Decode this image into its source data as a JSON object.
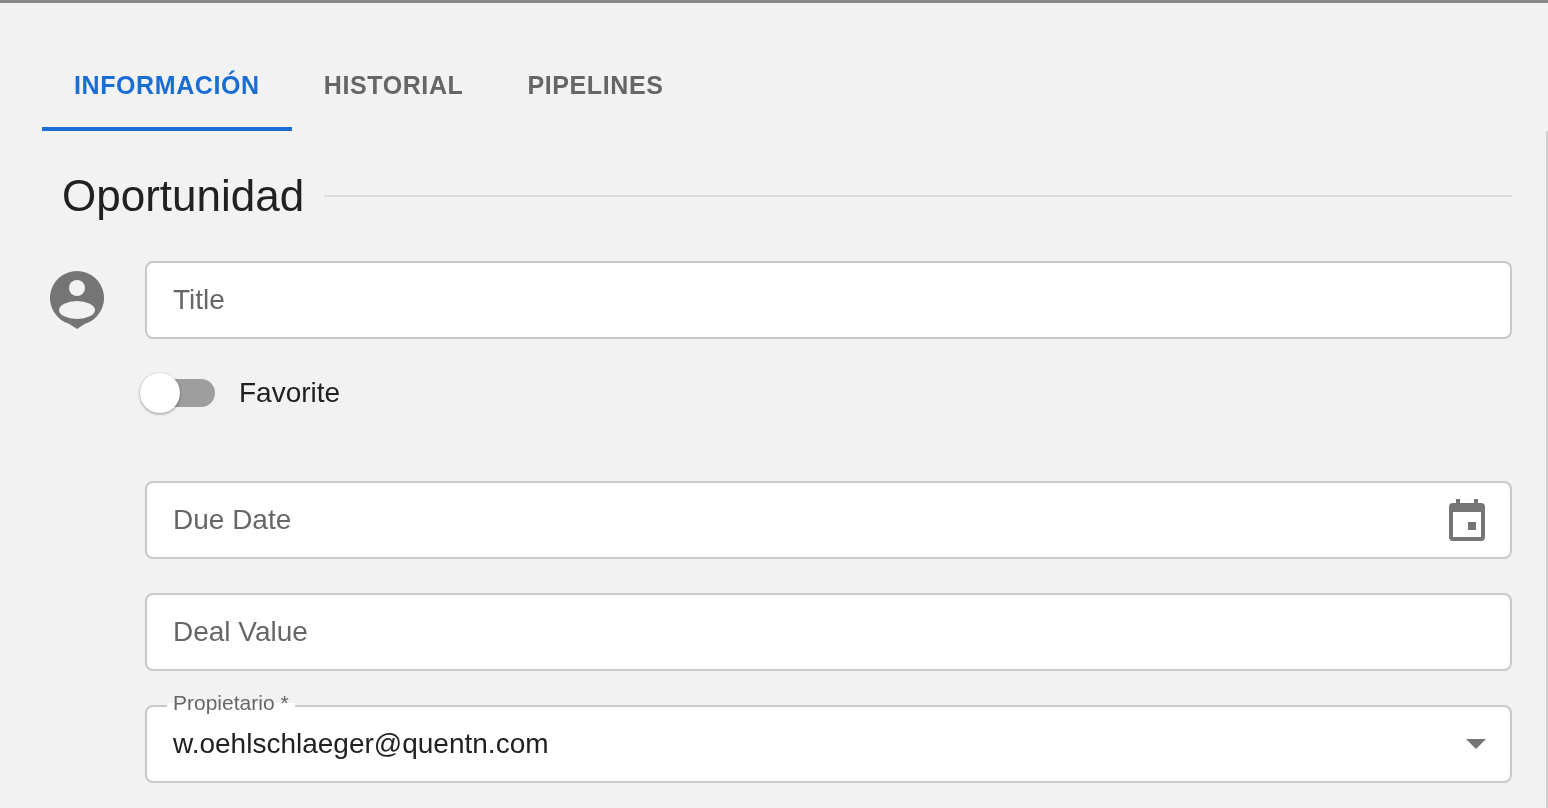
{
  "tabs": [
    {
      "label": "INFORMACIÓN",
      "selected": true
    },
    {
      "label": "HISTORIAL",
      "selected": false
    },
    {
      "label": "PIPELINES",
      "selected": false
    }
  ],
  "section": {
    "title": "Oportunidad"
  },
  "fields": [
    {
      "kind": "text",
      "placeholder": "Title"
    },
    {
      "kind": "switch",
      "label": "Favorite",
      "on": false
    },
    {
      "kind": "date",
      "placeholder": "Due Date"
    },
    {
      "kind": "text",
      "placeholder": "Deal Value"
    },
    {
      "kind": "select",
      "label": "Propietario *",
      "value": "w.oehlschlaeger@quentn.com"
    }
  ]
}
